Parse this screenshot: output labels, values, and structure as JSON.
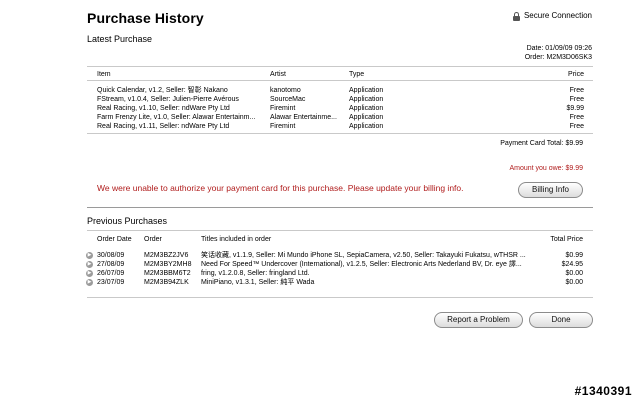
{
  "header": {
    "title": "Purchase History",
    "secure_label": "Secure Connection"
  },
  "latest": {
    "section_title": "Latest Purchase",
    "date": "Date: 01/09/09 09:26",
    "order": "Order: M2M3D06SK3",
    "columns": {
      "item": "Item",
      "artist": "Artist",
      "type": "Type",
      "price": "Price"
    },
    "rows": [
      {
        "item": "Quick Calendar, v1.2, Seller: 智彰 Nakano",
        "artist": "kanotomo",
        "type": "Application",
        "price": "Free"
      },
      {
        "item": "FStream, v1.0.4, Seller: Julien-Pierre Avérous",
        "artist": "SourceMac",
        "type": "Application",
        "price": "Free"
      },
      {
        "item": "Real Racing, v1.10, Seller: ndWare Pty Ltd",
        "artist": "Firemint",
        "type": "Application",
        "price": "$9.99"
      },
      {
        "item": "Farm Frenzy Lite, v1.0, Seller: Alawar Entertainm...",
        "artist": "Alawar Entertainme...",
        "type": "Application",
        "price": "Free"
      },
      {
        "item": "Real Racing, v1.11, Seller: ndWare Pty Ltd",
        "artist": "Firemint",
        "type": "Application",
        "price": "Free"
      }
    ],
    "payment_total": "Payment Card Total: $9.99",
    "amount_owed": "Amount you owe: $9.99",
    "warning": "We were unable to authorize your payment card for this purchase. Please update your billing info.",
    "billing_button": "Billing Info"
  },
  "previous": {
    "section_title": "Previous Purchases",
    "columns": {
      "date": "Order Date",
      "order": "Order",
      "titles": "Titles included in order",
      "total": "Total Price"
    },
    "rows": [
      {
        "date": "30/08/09",
        "order": "M2M3BZ2JV6",
        "titles": "笑话收藏, v1.1.9, Seller: Mi Mundo iPhone SL, SepiaCamera, v2.50, Seller: Takayuki Fukatsu, wTHSR ...",
        "total": "$0.99"
      },
      {
        "date": "27/08/09",
        "order": "M2M3BY2MH8",
        "titles": "Need For Speed™ Undercover (International), v1.2.5, Seller: Electronic Arts Nederland BV, Dr. eye 譯...",
        "total": "$24.95"
      },
      {
        "date": "26/07/09",
        "order": "M2M3BBM6T2",
        "titles": "fring, v1.2.0.8, Seller: fringland Ltd.",
        "total": "$0.00"
      },
      {
        "date": "23/07/09",
        "order": "M2M3B94ZLK",
        "titles": "MiniPiano, v1.3.1, Seller: 純平 Wada",
        "total": "$0.00"
      }
    ]
  },
  "footer": {
    "report_button": "Report a Problem",
    "done_button": "Done"
  },
  "watermark": "#1340391",
  "icons": {
    "secure": "lock-icon",
    "row_arrow": "arrow-right-circle-icon"
  },
  "colors": {
    "warning": "#b01c1c",
    "divider": "#c9c9c9"
  }
}
